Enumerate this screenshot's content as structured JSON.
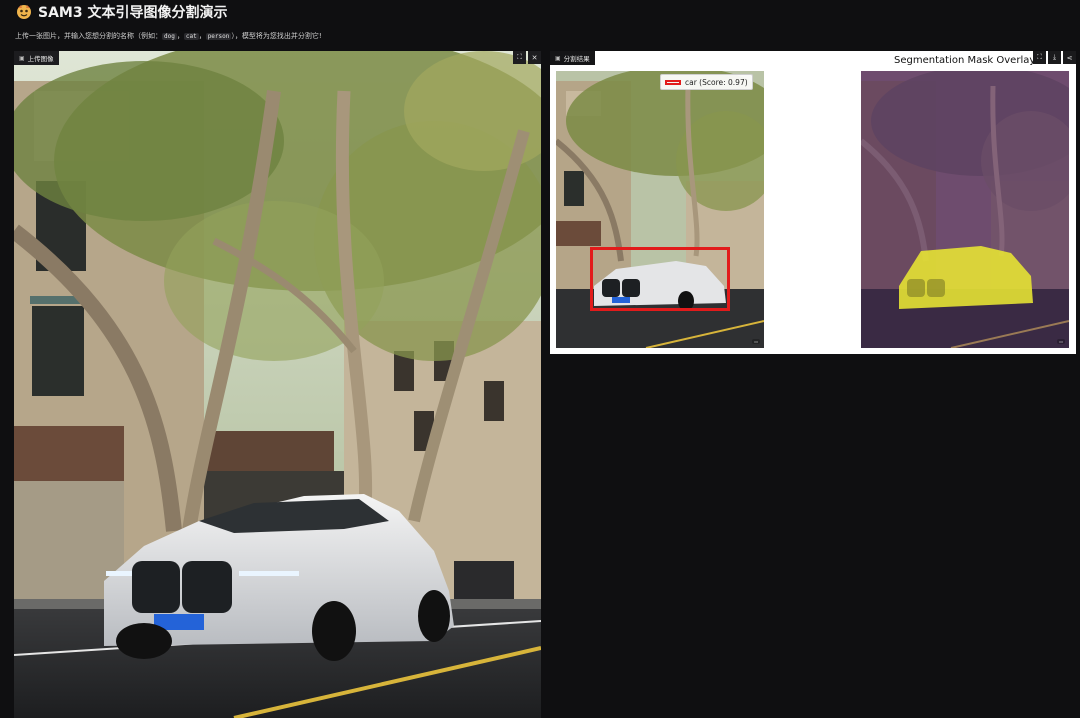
{
  "app": {
    "title": "SAM3 文本引导图像分割演示",
    "description_prefix": "上传一张图片，并输入您想分割的名称（例如：",
    "examples": [
      "dog",
      "cat",
      "person"
    ],
    "description_suffix": "），模型将为您找出并分割它!"
  },
  "upload_panel": {
    "label": "上传图像",
    "label_icon": "image-icon",
    "buttons": [
      {
        "name": "fullscreen-button",
        "icon": "fullscreen-icon",
        "glyph": "⛶"
      },
      {
        "name": "clear-button",
        "icon": "close-icon",
        "glyph": "✕"
      }
    ]
  },
  "result_panel": {
    "label": "分割结果",
    "label_icon": "image-icon",
    "plot_title": "Segmentation Mask Overlay",
    "legend": {
      "label": "car (Score: 0.97)",
      "color": "#e21b1b"
    },
    "mask_color": "#e6e234",
    "buttons": [
      {
        "name": "fullscreen-button",
        "icon": "fullscreen-icon",
        "glyph": "⛶"
      },
      {
        "name": "download-button",
        "icon": "download-icon",
        "glyph": "⤓"
      },
      {
        "name": "share-button",
        "icon": "share-icon",
        "glyph": "⋖"
      }
    ]
  }
}
